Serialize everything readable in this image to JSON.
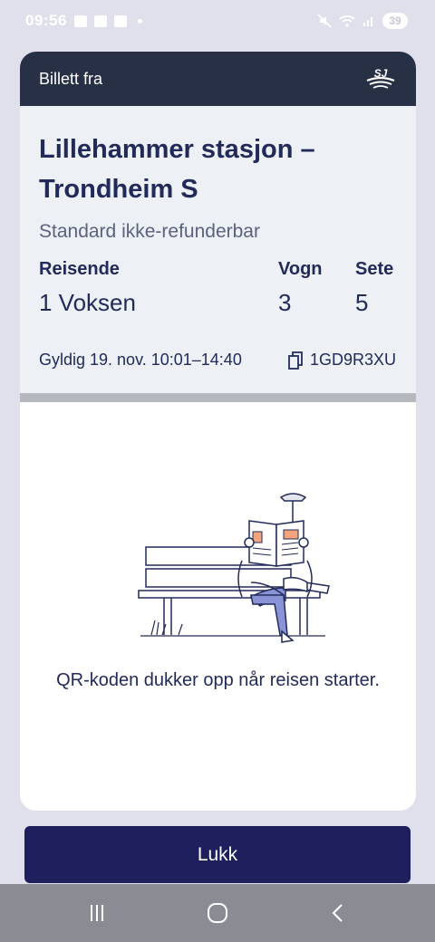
{
  "status_bar": {
    "time": "09:56",
    "battery": "39"
  },
  "ticket": {
    "header_label": "Billett fra",
    "logo_text": "SJ",
    "route": "Lillehammer stasjon – Trondheim S",
    "ticket_type": "Standard ikke-refunderbar",
    "travelers_label": "Reisende",
    "travelers_value": "1 Voksen",
    "car_label": "Vogn",
    "car_value": "3",
    "seat_label": "Sete",
    "seat_value": "5",
    "validity": "Gyldig 19. nov. 10:01–14:40",
    "booking_code": "1GD9R3XU"
  },
  "qr": {
    "message": "QR-koden dukker opp når reisen starter."
  },
  "close_button": {
    "label": "Lukk"
  },
  "colors": {
    "header_bg": "#283045",
    "primary_text": "#222a5a",
    "button_bg": "#1e1f5c",
    "page_bg": "#dfe0ec",
    "info_bg": "#edf1f5"
  },
  "icons": {
    "logo": "sj-logo-icon",
    "copy": "copy-icon",
    "nav_recent": "recent-apps-icon",
    "nav_home": "home-icon",
    "nav_back": "back-icon"
  }
}
